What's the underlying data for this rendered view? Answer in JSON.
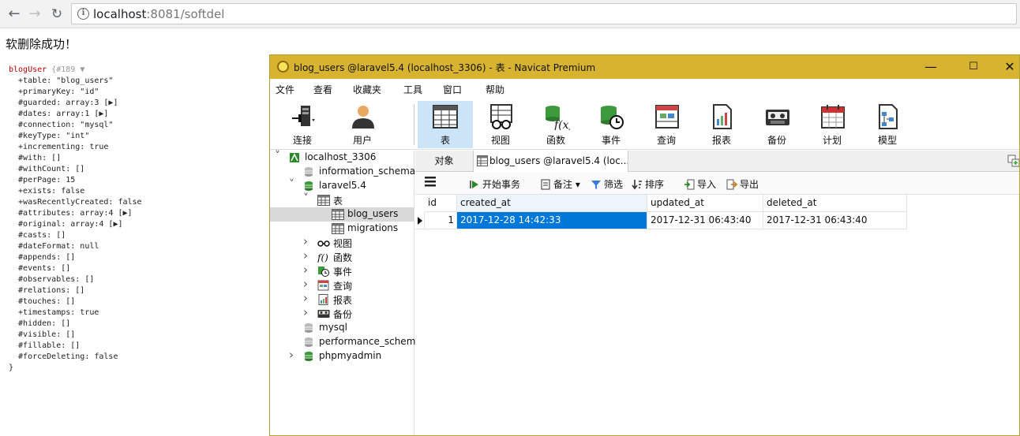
{
  "browser": {
    "url_host": "localhost",
    "url_rest": ":8081/softdel",
    "back_icon": "arrow-left-icon",
    "forward_icon": "arrow-right-icon",
    "reload_icon": "reload-icon"
  },
  "page": {
    "message": "软删除成功！",
    "dump": {
      "header_class": "blogUser",
      "header_rest": " {#189 ▼",
      "lines": [
        "  +table: \"blog_users\"",
        "  +primaryKey: \"id\"",
        "  #guarded: array:3 [▶]",
        "  #dates: array:1 [▶]",
        "  #connection: \"mysql\"",
        "  #keyType: \"int\"",
        "  +incrementing: true",
        "  #with: []",
        "  #withCount: []",
        "  #perPage: 15",
        "  +exists: false",
        "  +wasRecentlyCreated: false",
        "  #attributes: array:4 [▶]",
        "  #original: array:4 [▶]",
        "  #casts: []",
        "  #dateFormat: null",
        "  #appends: []",
        "  #events: []",
        "  #observables: []",
        "  #relations: []",
        "  #touches: []",
        "  +timestamps: true",
        "  #hidden: []",
        "  #visible: []",
        "  #fillable: []",
        "  #forceDeleting: false",
        "}"
      ]
    }
  },
  "navicat": {
    "title": "blog_users @laravel5.4 (localhost_3306) - 表 - Navicat Premium",
    "window_buttons": {
      "minimize": "—",
      "maximize": "☐",
      "close": "✕"
    },
    "menu": [
      "文件",
      "查看",
      "收藏夹",
      "工具",
      "窗口",
      "帮助"
    ],
    "toolbar": [
      {
        "label": "连接",
        "icon": "connection-icon"
      },
      {
        "label": "用户",
        "icon": "user-icon"
      },
      {
        "label": "表",
        "icon": "table-icon",
        "active": true
      },
      {
        "label": "视图",
        "icon": "view-icon"
      },
      {
        "label": "函数",
        "icon": "function-icon"
      },
      {
        "label": "事件",
        "icon": "event-icon"
      },
      {
        "label": "查询",
        "icon": "query-icon"
      },
      {
        "label": "报表",
        "icon": "report-icon"
      },
      {
        "label": "备份",
        "icon": "backup-icon"
      },
      {
        "label": "计划",
        "icon": "schedule-icon"
      },
      {
        "label": "模型",
        "icon": "model-icon"
      }
    ],
    "tree": [
      {
        "label": "localhost_3306",
        "icon": "server-icon",
        "indent": 0,
        "arrow": "v"
      },
      {
        "label": "information_schema",
        "icon": "database-icon",
        "indent": 1,
        "arrow": ""
      },
      {
        "label": "laravel5.4",
        "icon": "database-icon",
        "indent": 1,
        "arrow": "v",
        "green": true
      },
      {
        "label": "表",
        "icon": "table-icon",
        "indent": 2,
        "arrow": "v"
      },
      {
        "label": "blog_users",
        "icon": "table-icon",
        "indent": 3,
        "arrow": "",
        "selected": true
      },
      {
        "label": "migrations",
        "icon": "table-icon",
        "indent": 3,
        "arrow": ""
      },
      {
        "label": "视图",
        "icon": "view-icon",
        "indent": 2,
        "arrow": ">"
      },
      {
        "label": "函数",
        "icon": "function-icon",
        "indent": 2,
        "arrow": ">"
      },
      {
        "label": "事件",
        "icon": "event-icon",
        "indent": 2,
        "arrow": ">"
      },
      {
        "label": "查询",
        "icon": "query-icon",
        "indent": 2,
        "arrow": ">"
      },
      {
        "label": "报表",
        "icon": "report-icon",
        "indent": 2,
        "arrow": ">"
      },
      {
        "label": "备份",
        "icon": "backup-icon",
        "indent": 2,
        "arrow": ">"
      },
      {
        "label": "mysql",
        "icon": "database-icon",
        "indent": 1,
        "arrow": ""
      },
      {
        "label": "performance_schema",
        "icon": "database-icon",
        "indent": 1,
        "arrow": ""
      },
      {
        "label": "phpmyadmin",
        "icon": "database-icon",
        "indent": 1,
        "arrow": ">",
        "green": true
      }
    ],
    "tabs": {
      "objects": "对象",
      "table_tab": "blog_users @laravel5.4 (loc..."
    },
    "subtoolbar": {
      "begin_tx": "开始事务",
      "note": "备注",
      "filter": "筛选",
      "sort": "排序",
      "import": "导入",
      "export": "导出"
    },
    "grid": {
      "columns": [
        "id",
        "created_at",
        "updated_at",
        "deleted_at"
      ],
      "rows": [
        [
          "1",
          "2017-12-28 14:42:33",
          "2017-12-31 06:43:40",
          "2017-12-31 06:43:40"
        ]
      ]
    },
    "colors": {
      "title_bar": "#d7b32f",
      "selection": "#0078d7",
      "active_tool": "#cce4f7"
    }
  }
}
